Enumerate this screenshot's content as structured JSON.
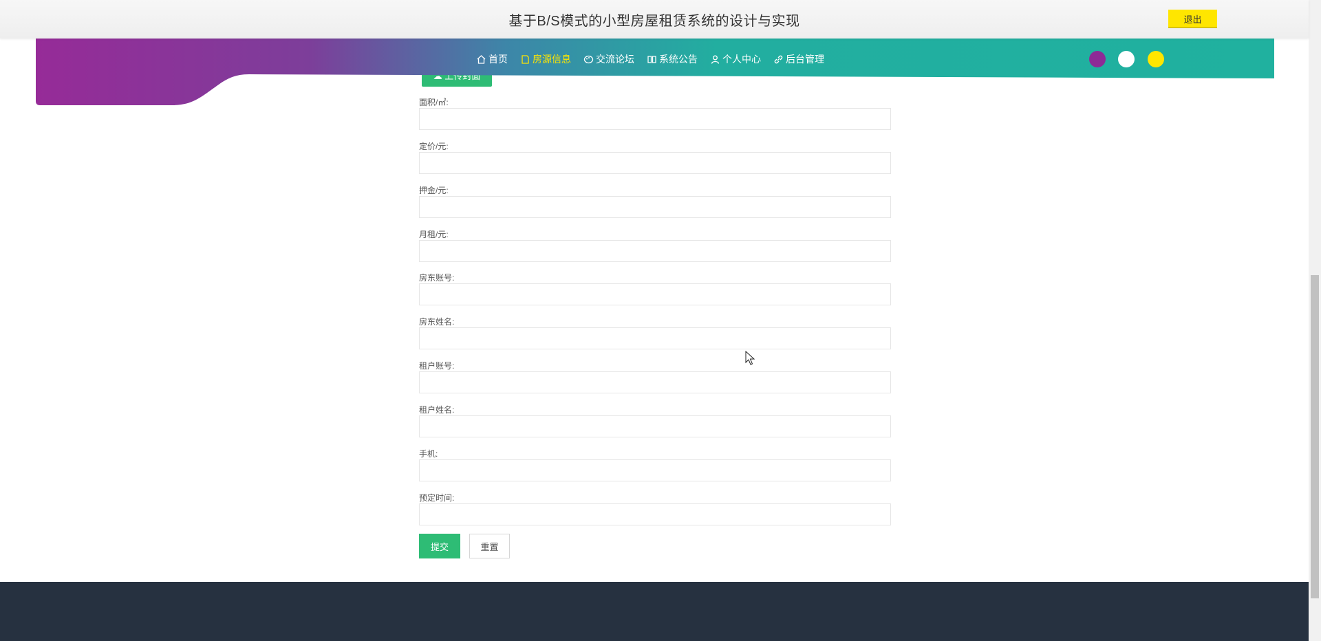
{
  "header": {
    "title": "基于B/S模式的小型房屋租赁系统的设计与实现",
    "logout_label": "退出"
  },
  "nav": {
    "items": [
      {
        "label": "首页",
        "icon": "home-icon"
      },
      {
        "label": "房源信息",
        "icon": "document-icon",
        "active": true
      },
      {
        "label": "交流论坛",
        "icon": "palette-icon"
      },
      {
        "label": "系统公告",
        "icon": "book-icon"
      },
      {
        "label": "个人中心",
        "icon": "user-icon"
      },
      {
        "label": "后台管理",
        "icon": "link-icon"
      }
    ],
    "theme_colors": [
      "#8e2a96",
      "#ffffff",
      "#ffe600"
    ],
    "gradient": [
      "#9a2a9a",
      "#22b0a0"
    ]
  },
  "form": {
    "upload_label": "上传封面",
    "fields": [
      {
        "label": "面积/㎡:",
        "value": ""
      },
      {
        "label": "定价/元:",
        "value": ""
      },
      {
        "label": "押金/元:",
        "value": ""
      },
      {
        "label": "月租/元:",
        "value": ""
      },
      {
        "label": "房东账号:",
        "value": ""
      },
      {
        "label": "房东姓名:",
        "value": ""
      },
      {
        "label": "租户账号:",
        "value": ""
      },
      {
        "label": "租户姓名:",
        "value": ""
      },
      {
        "label": "手机:",
        "value": ""
      },
      {
        "label": "预定时间:",
        "value": ""
      }
    ],
    "submit_label": "提交",
    "reset_label": "重置"
  },
  "colors": {
    "accent_green": "#2ebc75",
    "footer": "#263140",
    "logout_yellow": "#ffe600"
  }
}
